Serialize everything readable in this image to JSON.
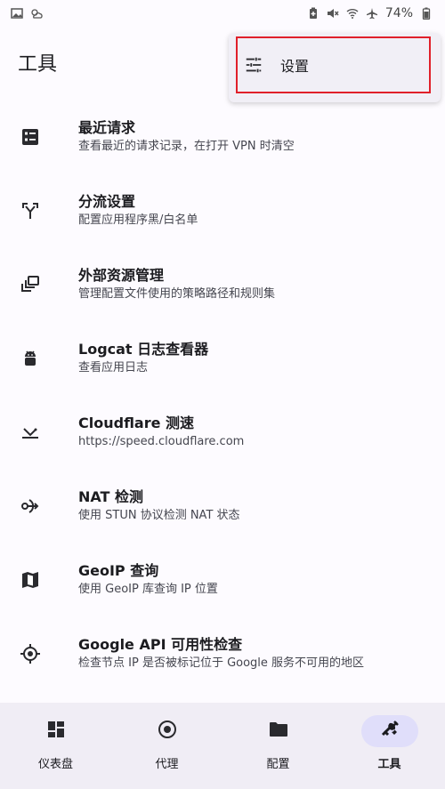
{
  "status_bar": {
    "battery_percent": "74%",
    "icons": [
      "image-icon",
      "weather-icon",
      "battery-saver-icon",
      "mute-icon",
      "wifi-icon",
      "airplane-icon",
      "battery-icon"
    ]
  },
  "header": {
    "title": "工具"
  },
  "menu": {
    "items": [
      {
        "label": "设置",
        "icon": "tune-icon"
      }
    ]
  },
  "tools": [
    {
      "title": "最近请求",
      "subtitle": "查看最近的请求记录，在打开 VPN 时清空",
      "icon": "list-icon"
    },
    {
      "title": "分流设置",
      "subtitle": "配置应用程序黑/白名单",
      "icon": "split-icon"
    },
    {
      "title": "外部资源管理",
      "subtitle": "管理配置文件使用的策略路径和规则集",
      "icon": "layers-icon"
    },
    {
      "title": "Logcat 日志查看器",
      "subtitle": "查看应用日志",
      "icon": "android-icon"
    },
    {
      "title": "Cloudflare 测速",
      "subtitle": "https://speed.cloudflare.com",
      "icon": "speed-icon"
    },
    {
      "title": "NAT 检测",
      "subtitle": "使用 STUN 协议检测 NAT 状态",
      "icon": "nat-icon"
    },
    {
      "title": "GeoIP 查询",
      "subtitle": "使用 GeoIP 库查询 IP 位置",
      "icon": "map-icon"
    },
    {
      "title": "Google API 可用性检查",
      "subtitle": "检查节点 IP 是否被标记位于 Google 服务不可用的地区",
      "icon": "target-icon"
    }
  ],
  "bottom_nav": {
    "active_index": 3,
    "items": [
      {
        "label": "仪表盘",
        "icon": "dashboard-icon"
      },
      {
        "label": "代理",
        "icon": "radio-button-icon"
      },
      {
        "label": "配置",
        "icon": "folder-icon"
      },
      {
        "label": "工具",
        "icon": "tools-icon"
      }
    ]
  },
  "colors": {
    "nav_background": "#f0edf5",
    "nav_active_pill": "#e0defa",
    "menu_background": "#f1eff6",
    "highlight_border": "#e0202a"
  }
}
